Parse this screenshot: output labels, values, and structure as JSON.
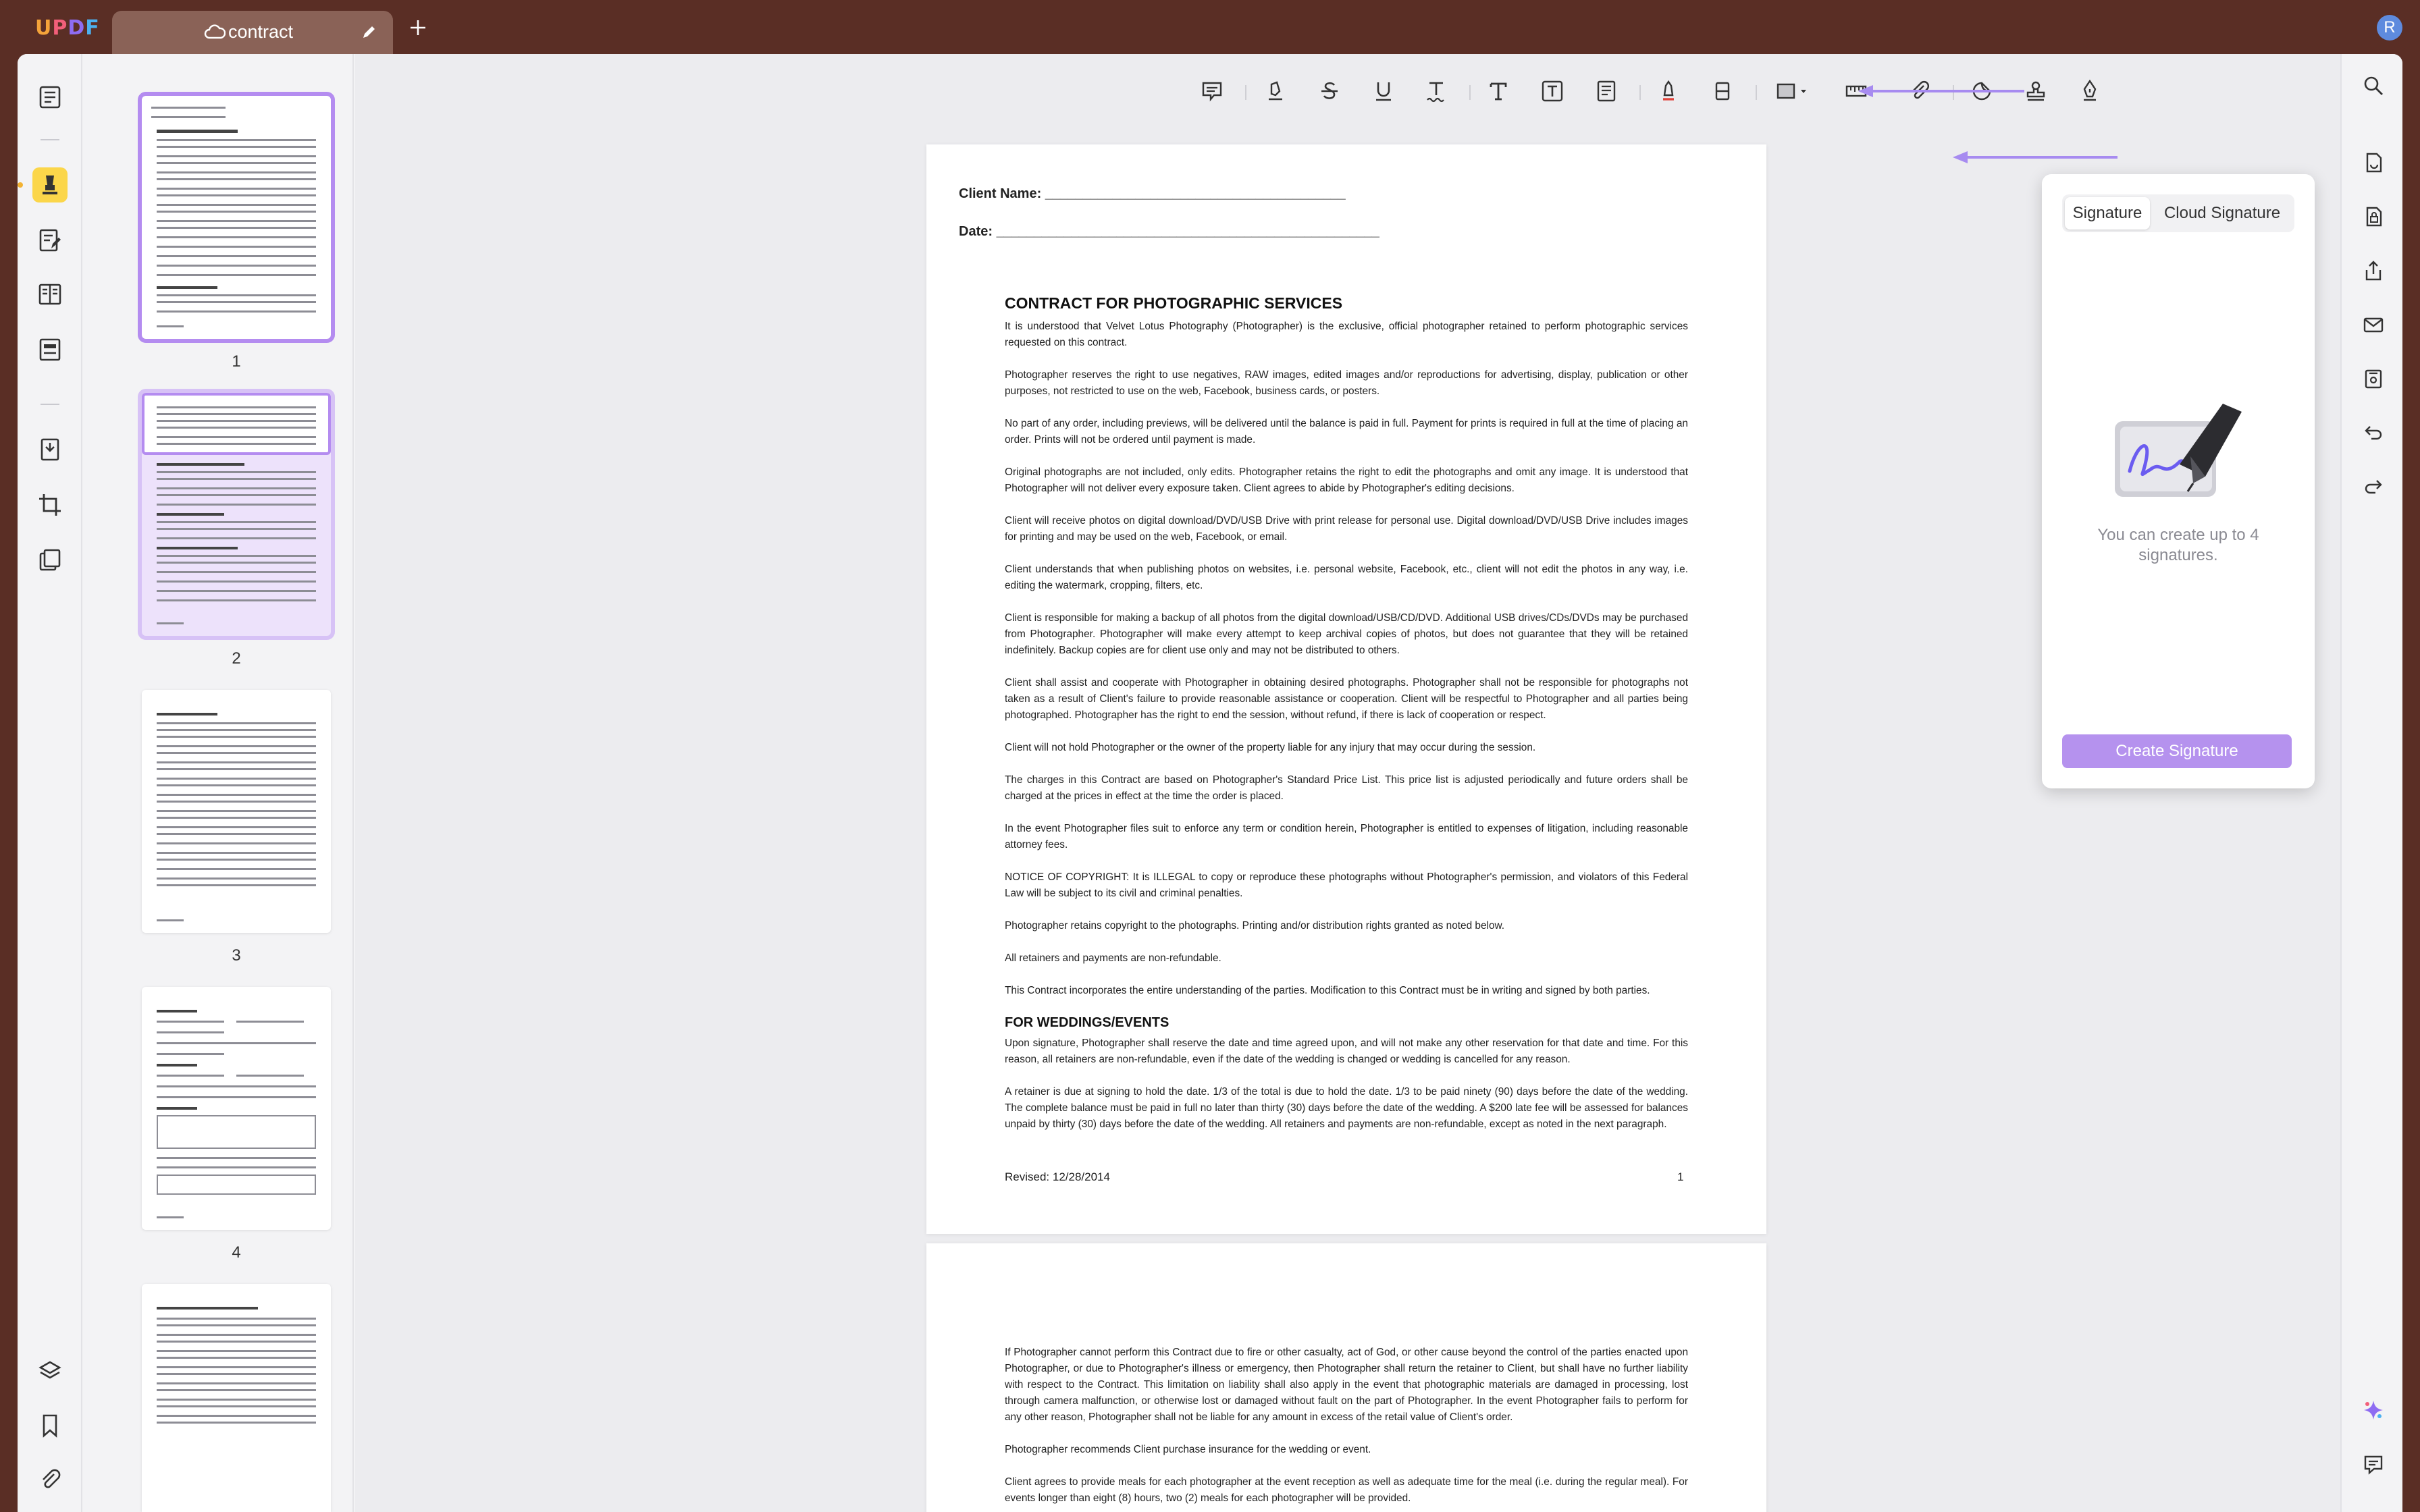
{
  "app": {
    "logo_text": "UPDF",
    "avatar_letter": "R"
  },
  "tab": {
    "title": "contract"
  },
  "thumbnails": [
    {
      "number": "1"
    },
    {
      "number": "2"
    },
    {
      "number": "3"
    },
    {
      "number": "4"
    }
  ],
  "document": {
    "page1": {
      "client_name_label": "Client Name: ________________________________________",
      "date_label": "Date: ___________________________________________________",
      "heading1": "CONTRACT FOR PHOTOGRAPHIC SERVICES",
      "paragraphs": [
        "It is understood that Velvet Lotus Photography (Photographer) is the exclusive, official photographer retained to perform photographic services requested on this contract.",
        "Photographer reserves the right to use negatives, RAW images, edited images and/or reproductions for advertising, display, publication or other purposes, not restricted to use on the web, Facebook, business cards, or posters.",
        "No part of any order, including previews, will be delivered until the balance is paid in full. Payment for prints is required in full at the time of placing an order. Prints will not be ordered until payment is made.",
        "Original photographs are not included, only edits. Photographer retains the right to edit the photographs and omit any image. It is understood that Photographer will not deliver every exposure taken. Client agrees to abide by Photographer's editing decisions.",
        "Client will receive photos on digital download/DVD/USB Drive with print release for personal use. Digital download/DVD/USB Drive includes images for printing and may be used on the web, Facebook, or email.",
        "Client understands that when publishing photos on websites, i.e. personal website, Facebook, etc., client will not edit the photos in any way, i.e. editing the watermark, cropping, filters, etc.",
        "Client is responsible for making a backup of all photos from the digital download/USB/CD/DVD. Additional USB drives/CDs/DVDs may be purchased from Photographer. Photographer will make every attempt to keep archival copies of photos, but does not guarantee that they will be retained indefinitely. Backup copies are for client use only and may not be distributed to others.",
        "Client shall assist and cooperate with Photographer in obtaining desired photographs. Photographer shall not be responsible for photographs not taken as a result of Client's failure to provide reasonable assistance or cooperation. Client will be respectful to Photographer and all parties being photographed. Photographer has the right to end the session, without refund, if there is lack of cooperation or respect.",
        "Client will not hold Photographer or the owner of the property liable for any injury that may occur during the session.",
        "The charges in this Contract are based on Photographer's Standard Price List. This price list is adjusted periodically and future orders shall be charged at the prices in effect at the time the order is placed.",
        "In the event Photographer files suit to enforce any term or condition herein, Photographer is entitled to expenses of litigation, including reasonable attorney fees.",
        "NOTICE OF COPYRIGHT: It is ILLEGAL to copy or reproduce these photographs without Photographer's permission, and violators of this Federal Law will be subject to its civil and criminal penalties.",
        "Photographer retains copyright to the photographs. Printing and/or distribution rights granted as noted below.",
        "All retainers and payments are non-refundable.",
        "This Contract incorporates the entire understanding of the parties. Modification to this Contract must be in writing and signed by both parties."
      ],
      "heading2": "FOR WEDDINGS/EVENTS",
      "paragraphs2": [
        "Upon signature, Photographer shall reserve the date and time agreed upon, and will not make any other reservation for that date and time. For this reason, all retainers are non-refundable, even if the date of the wedding is changed or wedding is cancelled for any reason.",
        "A retainer is due at signing to hold the date. 1/3 of the total is due to hold the date. 1/3 to be paid ninety (90) days before the date of the wedding. The complete balance must be paid in full no later than thirty (30) days before the date of the wedding. A $200 late fee will be assessed for balances unpaid by thirty (30) days before the date of the wedding. All retainers and payments are non-refundable, except as noted in the next paragraph."
      ],
      "footer_revised": "Revised: 12/28/2014",
      "footer_page": "1"
    },
    "page2": {
      "paragraphs": [
        "If Photographer cannot perform this Contract due to fire or other casualty, act of God, or other cause beyond the control of the parties enacted upon Photographer, or due to Photographer's illness or emergency, then Photographer shall return the retainer to Client, but shall have no further liability with respect to the Contract. This limitation on liability shall also apply in the event that photographic materials are damaged in processing, lost through camera malfunction, or otherwise lost or damaged without fault on the part of Photographer. In the event Photographer fails to perform for any other reason, Photographer shall not be liable for any amount in excess of the retail value of Client's order.",
        "Photographer recommends Client purchase insurance for the wedding or event.",
        "Client agrees to provide meals for each photographer at the event reception as well as adequate time for the meal (i.e. during the regular meal). For events longer than eight (8) hours, two (2) meals for each photographer will be provided."
      ]
    }
  },
  "signature_panel": {
    "tab_signature": "Signature",
    "tab_cloud_signature": "Cloud Signature",
    "info_text": "You can create up to 4 signatures.",
    "create_button": "Create Signature"
  },
  "colors": {
    "accent": "#b592ee",
    "arrow": "#a78bf0",
    "titlebar": "#5a2e25",
    "highlight_tool": "#fbd64a"
  }
}
